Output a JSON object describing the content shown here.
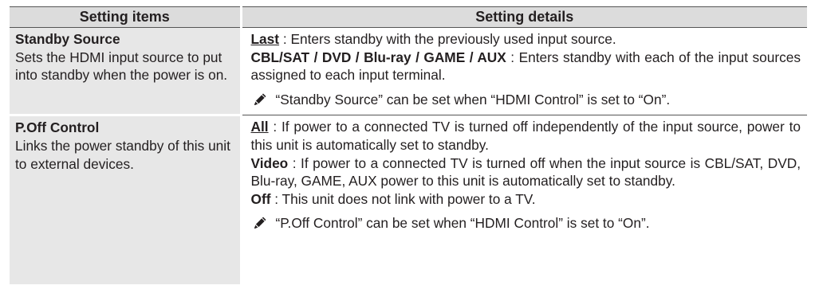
{
  "header": {
    "col1": "Setting items",
    "col2": "Setting details"
  },
  "rows": [
    {
      "item_title": "Standby Source",
      "item_desc": "Sets the HDMI input source to put into standby when the power is on.",
      "lines": [
        {
          "bold": "Last",
          "text": " : Enters standby with the previously used input source."
        },
        {
          "bold": "CBL/SAT / DVD / Blu-ray / GAME / AUX",
          "text": " : Enters standby with each of the input sources assigned to each input terminal."
        }
      ],
      "note": "“Standby Source” can be set when “HDMI Control” is set to “On”."
    },
    {
      "item_title": "P.Off Control",
      "item_desc": "Links the power standby of this unit to external devices.",
      "lines": [
        {
          "bold": "All",
          "text": " : If power to a connected TV is turned off independently of the input source, power to this unit is automatically set to standby."
        },
        {
          "bold": "Video",
          "text": " : If power to a connected TV is turned off when the input source is CBL/SAT, DVD, Blu-ray, GAME, AUX power to this unit is automatically set to standby."
        },
        {
          "bold": "Off",
          "text": " : This unit does not link with power to a TV."
        }
      ],
      "note": "“P.Off Control” can be set when “HDMI Control” is set to “On”."
    }
  ],
  "icons": {
    "note_icon": "pencil-icon"
  }
}
